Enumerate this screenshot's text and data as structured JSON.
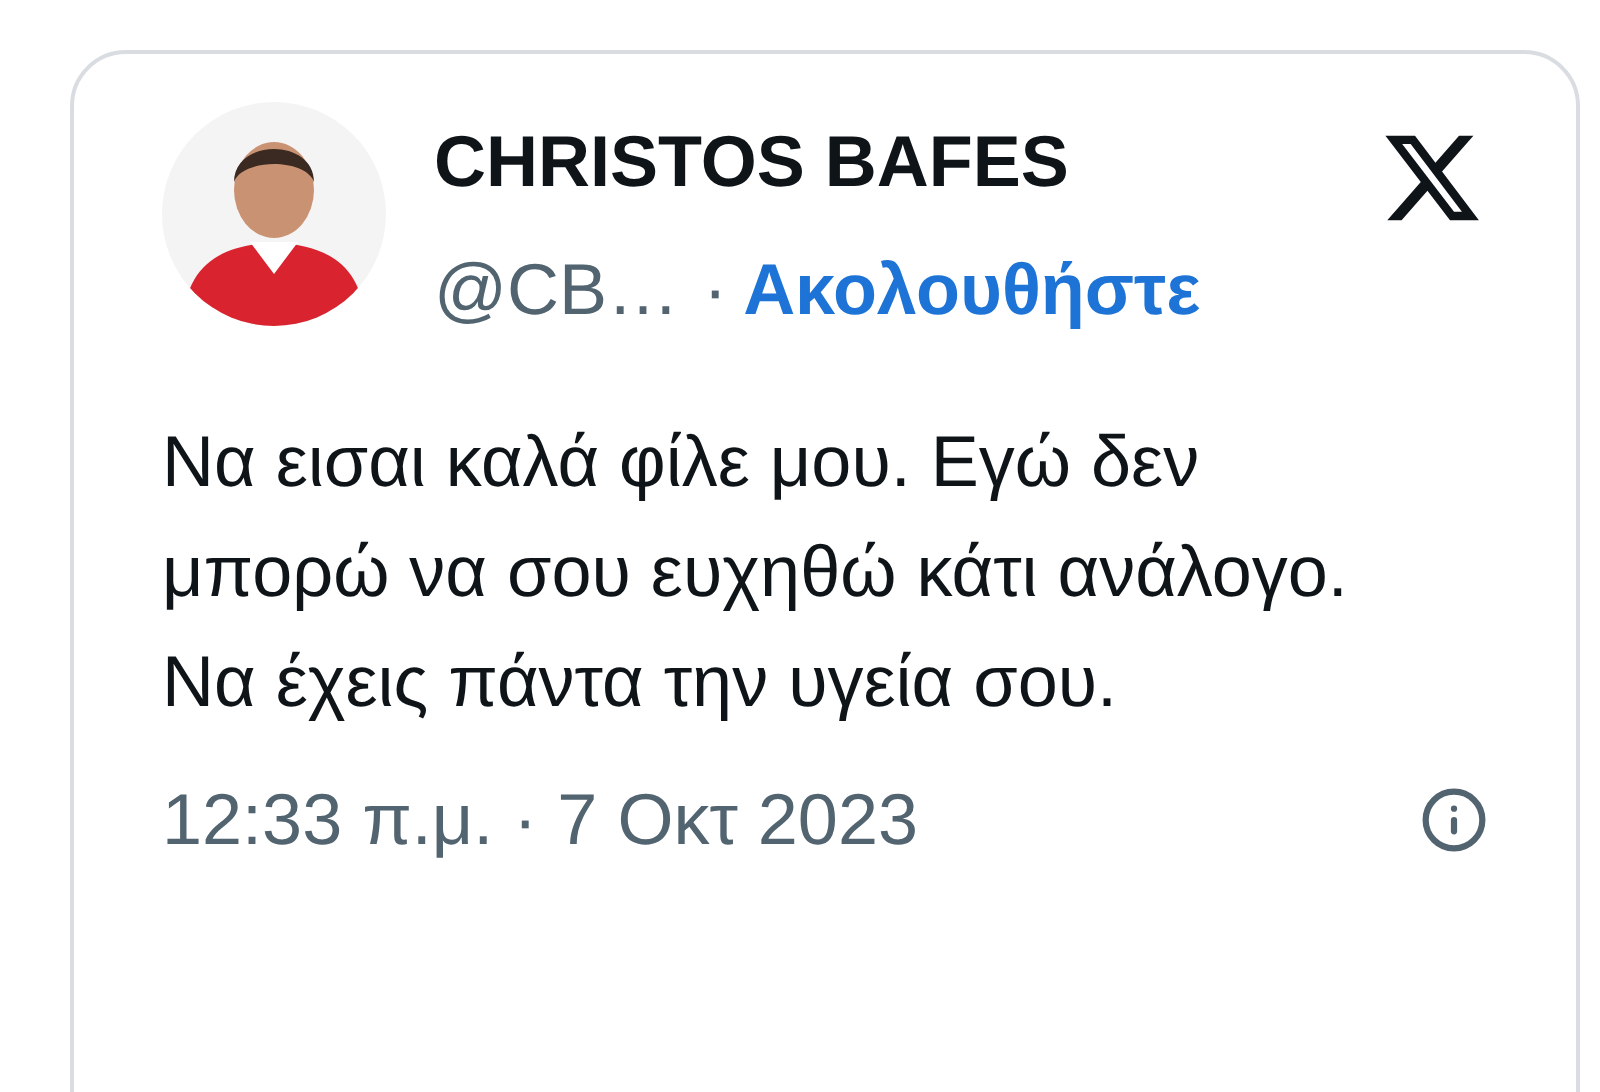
{
  "author": {
    "name": "CHRISTOS BAFES",
    "handle": "@CB…",
    "separator": "·",
    "follow": "Ακολουθήστε"
  },
  "text": "Να εισαι καλά φίλε μου. Εγώ δεν μπορώ να σου ευχηθώ κάτι ανάλογο. Να έχεις πάντα την υγεία σου.",
  "timestamp": "12:33 π.μ. · 7 Οκτ 2023"
}
